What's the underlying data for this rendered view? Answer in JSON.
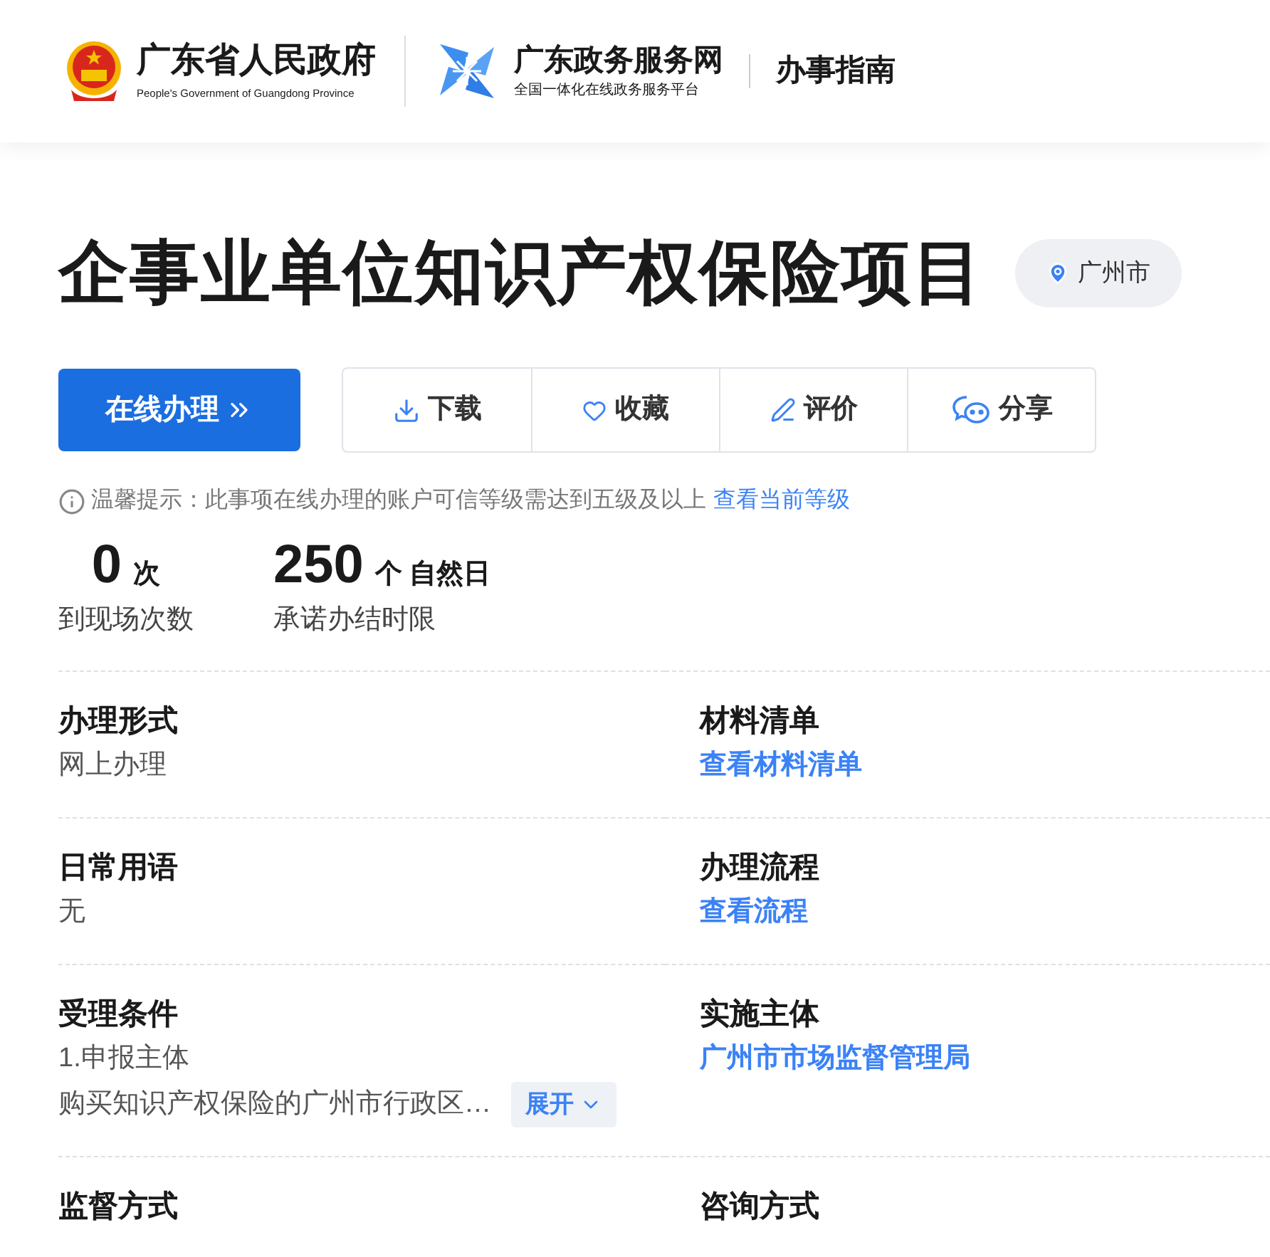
{
  "header": {
    "gov_title": "广东省人民政府",
    "gov_subtitle": "People's Government of Guangdong Province",
    "portal_title": "广东政务服务网",
    "portal_subtitle": "全国一体化在线政务服务平台",
    "section": "办事指南"
  },
  "title": "企事业单位知识产权保险项目",
  "location": "广州市",
  "primary_button": "在线办理",
  "actions": [
    {
      "kind": "download",
      "label": "下载"
    },
    {
      "kind": "favorite",
      "label": "收藏"
    },
    {
      "kind": "review",
      "label": "评价"
    },
    {
      "kind": "share",
      "label": "分享"
    }
  ],
  "notice": {
    "text": "温馨提示：此事项在线办理的账户可信等级需达到五级及以上",
    "link": "查看当前等级"
  },
  "stats": [
    {
      "value": "0",
      "unit": "次",
      "label": "到现场次数"
    },
    {
      "value": "250",
      "unit": "个 自然日",
      "label": "承诺办结时限"
    }
  ],
  "fields": [
    {
      "label": "办理形式",
      "lines": [
        {
          "kind": "text",
          "text": "网上办理"
        }
      ]
    },
    {
      "label": "材料清单",
      "lines": [
        {
          "kind": "link",
          "text": "查看材料清单"
        }
      ]
    },
    {
      "label": "日常用语",
      "lines": [
        {
          "kind": "text",
          "text": "无"
        }
      ]
    },
    {
      "label": "办理流程",
      "lines": [
        {
          "kind": "link",
          "text": "查看流程"
        }
      ]
    },
    {
      "label": "受理条件",
      "lines": [
        {
          "kind": "text",
          "text": "1.申报主体"
        },
        {
          "kind": "text",
          "text": "购买知识产权保险的广州市行政区…"
        }
      ],
      "expand": "展开"
    },
    {
      "label": "实施主体",
      "lines": [
        {
          "kind": "link",
          "text": "广州市市场监督管理局"
        }
      ]
    },
    {
      "label": "监督方式"
    },
    {
      "label": "咨询方式"
    }
  ]
}
